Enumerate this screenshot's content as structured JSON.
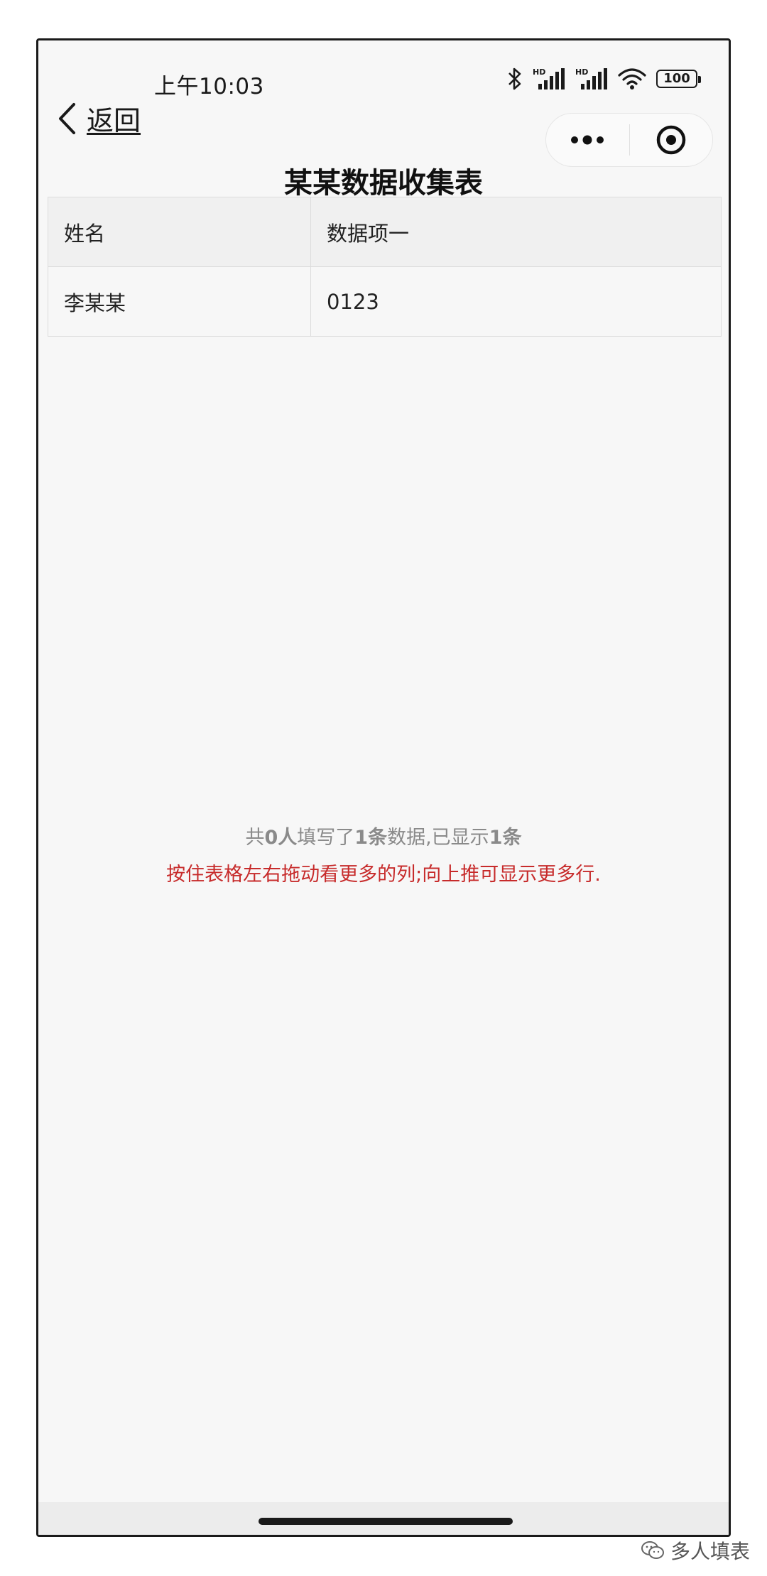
{
  "status": {
    "time": "上午10:03",
    "battery": "100",
    "icons": [
      "bluetooth-icon",
      "hd-signal-icon",
      "hd-signal-icon",
      "wifi-icon",
      "battery-icon"
    ]
  },
  "nav": {
    "back_label": "返回",
    "capsule_icons": [
      "more-dots-icon",
      "close-target-icon"
    ]
  },
  "page_title": "某某数据收集表",
  "table": {
    "headers": [
      "姓名",
      "数据项一"
    ],
    "rows": [
      [
        "李某某",
        "0123"
      ]
    ]
  },
  "summary": {
    "prefix": "共",
    "people": "0人",
    "mid1": "填写了",
    "count": "1条",
    "mid2": "数据,已显示",
    "shown": "1条"
  },
  "hint": "按住表格左右拖动看更多的列;向上推可显示更多行.",
  "watermark": "多人填表",
  "colors": {
    "hint_red": "#c72b2b",
    "summary_gray": "#8a8a8a",
    "header_bg": "#f0f0f0"
  }
}
